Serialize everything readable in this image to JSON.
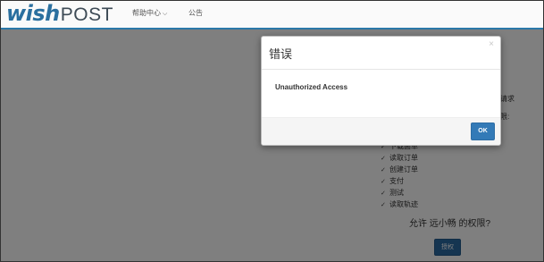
{
  "header": {
    "logo_wish": "wish",
    "logo_post": "POST",
    "nav_help": "帮助中心",
    "nav_help_chevron": "⌵",
    "nav_notice": "公告"
  },
  "content": {
    "side_text_1": "请求",
    "side_text_2": "限:",
    "permissions": [
      {
        "check": "✓",
        "label": "下载面单"
      },
      {
        "check": "✓",
        "label": "读取订单"
      },
      {
        "check": "✓",
        "label": "创建订单"
      },
      {
        "check": "✓",
        "label": "支付"
      },
      {
        "check": "✓",
        "label": "测试"
      },
      {
        "check": "✓",
        "label": "读取轨迹"
      }
    ],
    "question": "允许 远小畅 的权限?",
    "authorize_label": "授权"
  },
  "modal": {
    "title": "错误",
    "close": "×",
    "message": "Unauthorized Access",
    "ok_label": "OK"
  },
  "colors": {
    "brand_blue": "#2a6f9f",
    "nav_underline": "#2b78a8",
    "primary_button": "#337ab7",
    "backdrop": "rgba(0,0,0,0.5)"
  }
}
